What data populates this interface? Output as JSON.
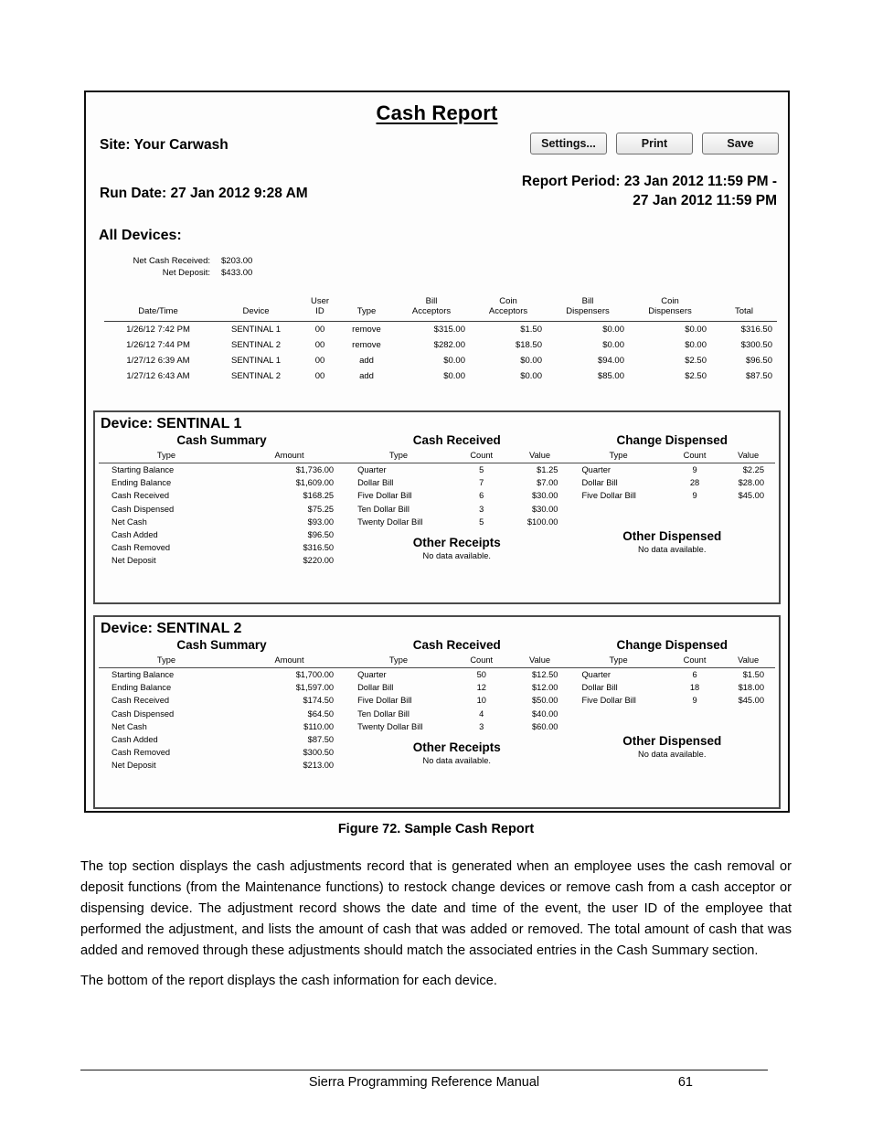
{
  "report": {
    "title": "Cash Report",
    "site_label": "Site:",
    "site_value": "Your Carwash",
    "run_date": "Run Date: 27 Jan 2012 9:28 AM",
    "report_period_line1": "Report Period: 23 Jan 2012 11:59 PM -",
    "report_period_line2": "27 Jan 2012 11:59 PM",
    "buttons": {
      "settings": "Settings...",
      "print": "Print",
      "save": "Save"
    },
    "all_devices_heading": "All Devices:",
    "net_summary": [
      {
        "label": "Net Cash Received:",
        "value": "$203.00"
      },
      {
        "label": "Net Deposit:",
        "value": "$433.00"
      }
    ],
    "adjustments": {
      "headers": [
        "Date/Time",
        "Device",
        "User\nID",
        "Type",
        "Bill\nAcceptors",
        "Coin\nAcceptors",
        "Bill\nDispensers",
        "Coin\nDispensers",
        "Total"
      ],
      "header_parts": [
        [
          "Date/Time",
          ""
        ],
        [
          "Device",
          ""
        ],
        [
          "User",
          "ID"
        ],
        [
          "Type",
          ""
        ],
        [
          "Bill",
          "Acceptors"
        ],
        [
          "Coin",
          "Acceptors"
        ],
        [
          "Bill",
          "Dispensers"
        ],
        [
          "Coin",
          "Dispensers"
        ],
        [
          "Total",
          ""
        ]
      ],
      "rows": [
        {
          "datetime": "1/26/12 7:42 PM",
          "device": "SENTINAL 1",
          "user_id": "00",
          "type": "remove",
          "bill_acceptors": "$315.00",
          "coin_acceptors": "$1.50",
          "bill_dispensers": "$0.00",
          "coin_dispensers": "$0.00",
          "total": "$316.50"
        },
        {
          "datetime": "1/26/12 7:44 PM",
          "device": "SENTINAL 2",
          "user_id": "00",
          "type": "remove",
          "bill_acceptors": "$282.00",
          "coin_acceptors": "$18.50",
          "bill_dispensers": "$0.00",
          "coin_dispensers": "$0.00",
          "total": "$300.50"
        },
        {
          "datetime": "1/27/12 6:39 AM",
          "device": "SENTINAL 1",
          "user_id": "00",
          "type": "add",
          "bill_acceptors": "$0.00",
          "coin_acceptors": "$0.00",
          "bill_dispensers": "$94.00",
          "coin_dispensers": "$2.50",
          "total": "$96.50"
        },
        {
          "datetime": "1/27/12 6:43 AM",
          "device": "SENTINAL 2",
          "user_id": "00",
          "type": "add",
          "bill_acceptors": "$0.00",
          "coin_acceptors": "$0.00",
          "bill_dispensers": "$85.00",
          "coin_dispensers": "$2.50",
          "total": "$87.50"
        }
      ]
    },
    "devices": [
      {
        "title": "Device: SENTINAL 1",
        "cash_summary": {
          "heading": "Cash Summary",
          "col_type": "Type",
          "col_amount": "Amount",
          "rows": [
            {
              "type": "Starting Balance",
              "amount": "$1,736.00"
            },
            {
              "type": "Ending Balance",
              "amount": "$1,609.00"
            },
            {
              "type": "Cash Received",
              "amount": "$168.25"
            },
            {
              "type": "Cash Dispensed",
              "amount": "$75.25"
            },
            {
              "type": "Net Cash",
              "amount": "$93.00"
            },
            {
              "type": "Cash Added",
              "amount": "$96.50"
            },
            {
              "type": "Cash Removed",
              "amount": "$316.50"
            },
            {
              "type": "Net Deposit",
              "amount": "$220.00"
            }
          ]
        },
        "cash_received": {
          "heading": "Cash Received",
          "col_type": "Type",
          "col_count": "Count",
          "col_value": "Value",
          "rows": [
            {
              "type": "Quarter",
              "count": "5",
              "value": "$1.25"
            },
            {
              "type": "Dollar Bill",
              "count": "7",
              "value": "$7.00"
            },
            {
              "type": "Five Dollar Bill",
              "count": "6",
              "value": "$30.00"
            },
            {
              "type": "Ten Dollar Bill",
              "count": "3",
              "value": "$30.00"
            },
            {
              "type": "Twenty Dollar Bill",
              "count": "5",
              "value": "$100.00"
            }
          ],
          "other_heading": "Other Receipts",
          "other_note": "No data available."
        },
        "change_dispensed": {
          "heading": "Change Dispensed",
          "col_type": "Type",
          "col_count": "Count",
          "col_value": "Value",
          "rows": [
            {
              "type": "Quarter",
              "count": "9",
              "value": "$2.25"
            },
            {
              "type": "Dollar Bill",
              "count": "28",
              "value": "$28.00"
            },
            {
              "type": "Five Dollar Bill",
              "count": "9",
              "value": "$45.00"
            }
          ],
          "other_heading": "Other Dispensed",
          "other_note": "No data available."
        }
      },
      {
        "title": "Device: SENTINAL 2",
        "cash_summary": {
          "heading": "Cash Summary",
          "col_type": "Type",
          "col_amount": "Amount",
          "rows": [
            {
              "type": "Starting Balance",
              "amount": "$1,700.00"
            },
            {
              "type": "Ending Balance",
              "amount": "$1,597.00"
            },
            {
              "type": "Cash Received",
              "amount": "$174.50"
            },
            {
              "type": "Cash Dispensed",
              "amount": "$64.50"
            },
            {
              "type": "Net Cash",
              "amount": "$110.00"
            },
            {
              "type": "Cash Added",
              "amount": "$87.50"
            },
            {
              "type": "Cash Removed",
              "amount": "$300.50"
            },
            {
              "type": "Net Deposit",
              "amount": "$213.00"
            }
          ]
        },
        "cash_received": {
          "heading": "Cash Received",
          "col_type": "Type",
          "col_count": "Count",
          "col_value": "Value",
          "rows": [
            {
              "type": "Quarter",
              "count": "50",
              "value": "$12.50"
            },
            {
              "type": "Dollar Bill",
              "count": "12",
              "value": "$12.00"
            },
            {
              "type": "Five Dollar Bill",
              "count": "10",
              "value": "$50.00"
            },
            {
              "type": "Ten Dollar Bill",
              "count": "4",
              "value": "$40.00"
            },
            {
              "type": "Twenty Dollar Bill",
              "count": "3",
              "value": "$60.00"
            }
          ],
          "other_heading": "Other Receipts",
          "other_note": "No data available."
        },
        "change_dispensed": {
          "heading": "Change Dispensed",
          "col_type": "Type",
          "col_count": "Count",
          "col_value": "Value",
          "rows": [
            {
              "type": "Quarter",
              "count": "6",
              "value": "$1.50"
            },
            {
              "type": "Dollar Bill",
              "count": "18",
              "value": "$18.00"
            },
            {
              "type": "Five Dollar Bill",
              "count": "9",
              "value": "$45.00"
            }
          ],
          "other_heading": "Other Dispensed",
          "other_note": "No data available."
        }
      }
    ]
  },
  "document": {
    "caption": "Figure 72. Sample Cash Report",
    "paragraph1": "The top section displays the cash adjustments record that is generated when an employee uses the cash removal or deposit functions (from the Maintenance functions) to restock change devices or remove cash from a cash acceptor or dispensing device. The adjustment record shows the date and time of the event, the user ID of the employee that performed the adjustment, and lists the amount of cash that was added or removed. The total amount of cash that was added and removed through these adjustments should match the associated entries in the Cash Summary section.",
    "paragraph2": " The bottom of the report displays the cash information for each device.",
    "footer_title": "Sierra Programming Reference Manual",
    "footer_page": "61"
  }
}
